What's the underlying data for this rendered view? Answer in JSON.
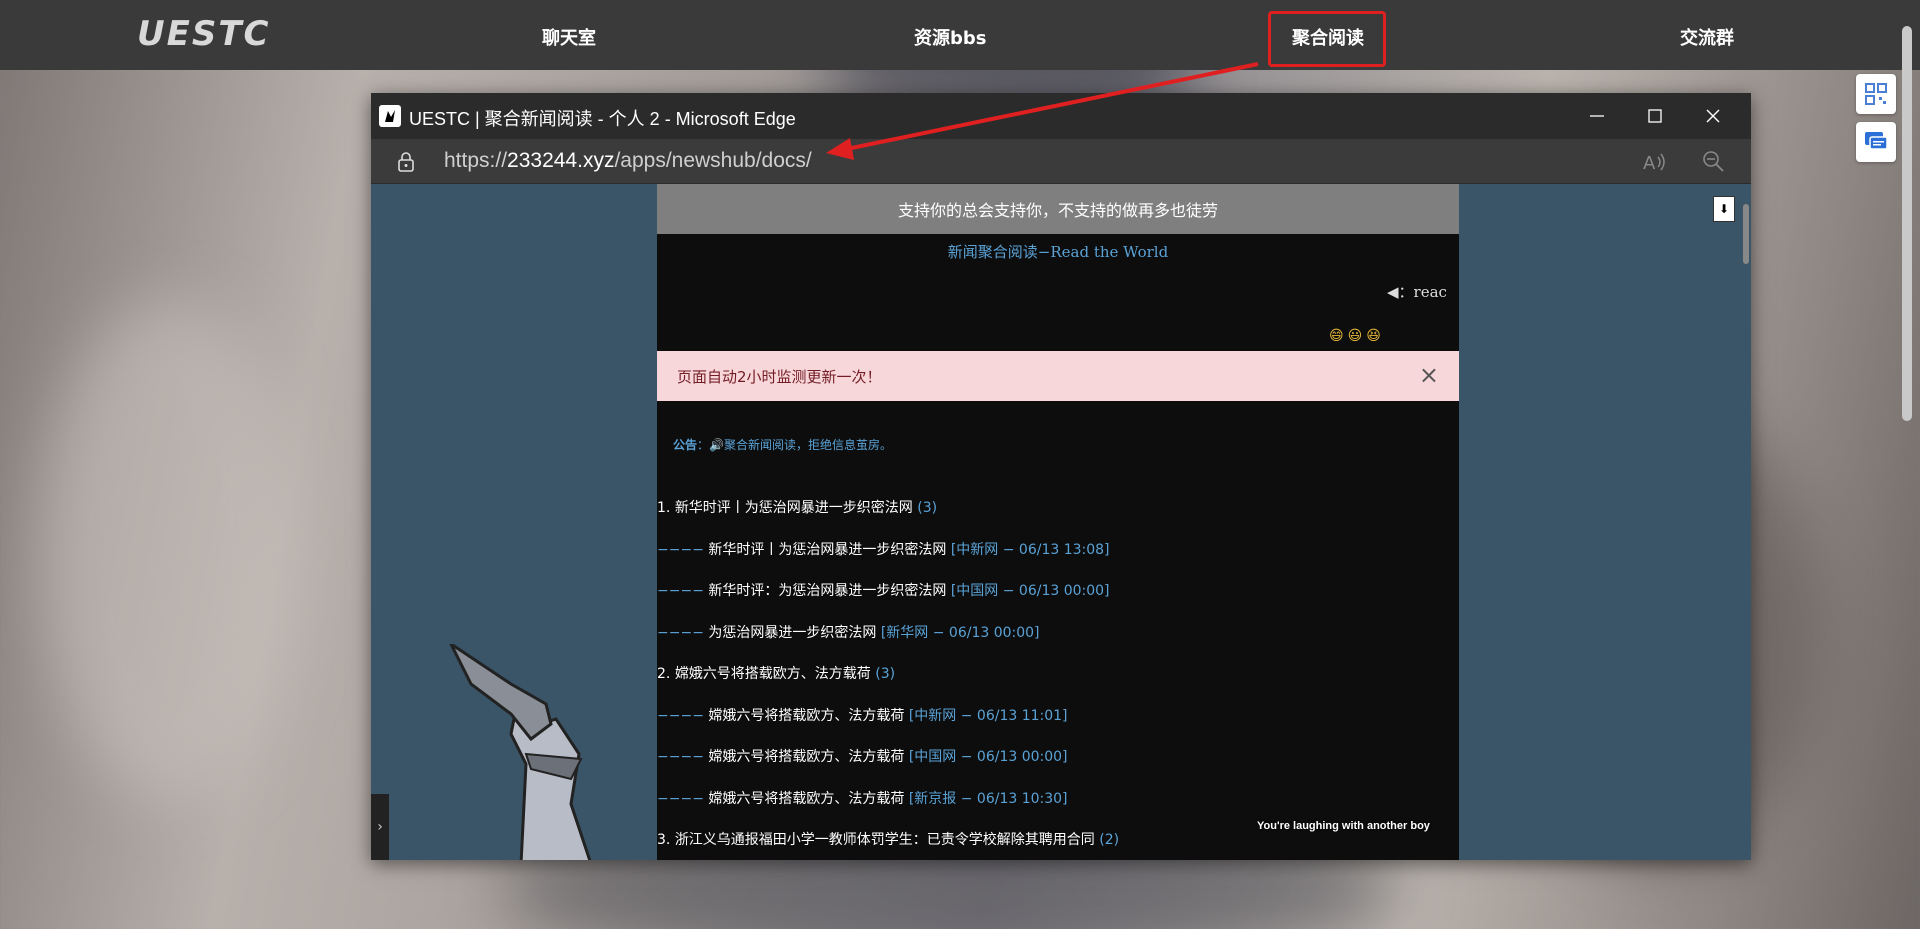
{
  "site": {
    "logo": "UESTC",
    "nav": [
      "聊天室",
      "资源bbs",
      "聚合阅读",
      "交流群"
    ],
    "highlight_color": "#e02020"
  },
  "edge": {
    "title": "UESTC | 聚合新闻阅读 - 个人 2 - Microsoft Edge",
    "url_prefix": "https://",
    "url_domain": "233244.xyz",
    "url_path": "/apps/newshub/docs/",
    "icons": [
      "lock-icon",
      "read-aloud-icon",
      "zoom-out-icon",
      "minimize-icon",
      "maximize-icon",
      "close-icon"
    ]
  },
  "page": {
    "banner": "支持你的总会支持你，不支持的做再多也徒劳",
    "site_title": "新闻聚合阅读−Read the World",
    "marquee": "◀：reac",
    "emojis": "😄😃😆",
    "alert": "页面自动2小时监测更新一次！",
    "notice_label": "公告",
    "notice_text": "：🔊聚合新闻阅读，拒绝信息茧房。",
    "tooltip": "You're laughing with another boy",
    "download_label": "⬇"
  },
  "news": [
    {
      "type": "head",
      "num": "1.",
      "title": "新华时评丨为惩治网暴进一步织密法网",
      "count": "(3)"
    },
    {
      "type": "sub",
      "title": "新华时评丨为惩治网暴进一步织密法网",
      "meta": "[中新网 − 06/13 13:08]"
    },
    {
      "type": "sub",
      "title": "新华时评：为惩治网暴进一步织密法网",
      "meta": "[中国网 − 06/13 00:00]"
    },
    {
      "type": "sub",
      "title": "为惩治网暴进一步织密法网",
      "meta": "[新华网 − 06/13 00:00]"
    },
    {
      "type": "head",
      "num": "2.",
      "title": "嫦娥六号将搭载欧方、法方载荷",
      "count": "(3)"
    },
    {
      "type": "sub",
      "title": "嫦娥六号将搭载欧方、法方载荷",
      "meta": "[中新网 − 06/13 11:01]"
    },
    {
      "type": "sub",
      "title": "嫦娥六号将搭载欧方、法方载荷",
      "meta": "[中国网 − 06/13 00:00]"
    },
    {
      "type": "sub",
      "title": "嫦娥六号将搭载欧方、法方载荷",
      "meta": "[新京报 − 06/13 10:30]"
    },
    {
      "type": "head",
      "num": "3.",
      "title": "浙江义乌通报福田小学一教师体罚学生：已责令学校解除其聘用合同",
      "count": "(2)"
    }
  ]
}
